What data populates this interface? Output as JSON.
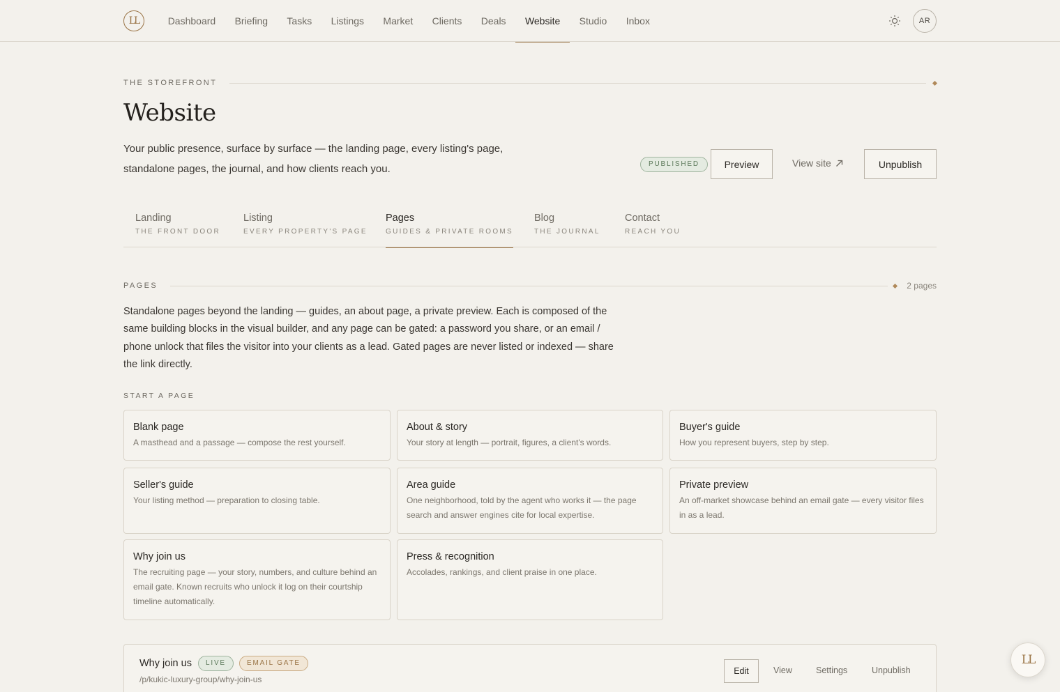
{
  "brand": {
    "logo_text": "LL",
    "accent": "#9a7446"
  },
  "nav": {
    "items": [
      {
        "label": "Dashboard"
      },
      {
        "label": "Briefing"
      },
      {
        "label": "Tasks"
      },
      {
        "label": "Listings"
      },
      {
        "label": "Market"
      },
      {
        "label": "Clients"
      },
      {
        "label": "Deals"
      },
      {
        "label": "Website"
      },
      {
        "label": "Studio"
      },
      {
        "label": "Inbox"
      }
    ],
    "active": "Website",
    "theme_icon": "sun-icon",
    "avatar_initials": "AR"
  },
  "header": {
    "eyebrow": "THE STOREFRONT",
    "title": "Website",
    "subtitle": "Your public presence, surface by surface — the landing page, every listing's page, standalone pages, the journal, and how clients reach you.",
    "status": "PUBLISHED",
    "preview_label": "Preview",
    "view_site_label": "View site",
    "unpublish_label": "Unpublish"
  },
  "tabs": [
    {
      "label": "Landing",
      "sub": "THE FRONT DOOR"
    },
    {
      "label": "Listing",
      "sub": "EVERY PROPERTY'S PAGE"
    },
    {
      "label": "Pages",
      "sub": "GUIDES & PRIVATE ROOMS"
    },
    {
      "label": "Blog",
      "sub": "THE JOURNAL"
    },
    {
      "label": "Contact",
      "sub": "REACH YOU"
    }
  ],
  "active_tab": "Pages",
  "pages_section": {
    "label": "PAGES",
    "count": "2 pages",
    "description": "Standalone pages beyond the landing — guides, an about page, a private preview. Each is composed of the same building blocks in the visual builder, and any page can be gated: a password you share, or an email / phone unlock that files the visitor into your clients as a lead. Gated pages are never listed or indexed — share the link directly.",
    "start_label": "START A PAGE",
    "templates": [
      {
        "title": "Blank page",
        "desc": "A masthead and a passage — compose the rest yourself."
      },
      {
        "title": "About & story",
        "desc": "Your story at length — portrait, figures, a client's words."
      },
      {
        "title": "Buyer's guide",
        "desc": "How you represent buyers, step by step."
      },
      {
        "title": "Seller's guide",
        "desc": "Your listing method — preparation to closing table."
      },
      {
        "title": "Area guide",
        "desc": "One neighborhood, told by the agent who works it — the page search and answer engines cite for local expertise."
      },
      {
        "title": "Private preview",
        "desc": "An off-market showcase behind an email gate — every visitor files in as a lead."
      },
      {
        "title": "Why join us",
        "desc": "The recruiting page — your story, numbers, and culture behind an email gate. Known recruits who unlock it log on their courtship timeline automatically."
      },
      {
        "title": "Press & recognition",
        "desc": "Accolades, rankings, and client praise in one place."
      }
    ],
    "existing": [
      {
        "title": "Why join us",
        "badges": [
          "LIVE",
          "EMAIL GATE"
        ],
        "path": "/p/kukic-luxury-group/why-join-us",
        "actions": {
          "edit": "Edit",
          "view": "View",
          "settings": "Settings",
          "unpublish": "Unpublish"
        }
      }
    ]
  },
  "fab_text": "LL"
}
